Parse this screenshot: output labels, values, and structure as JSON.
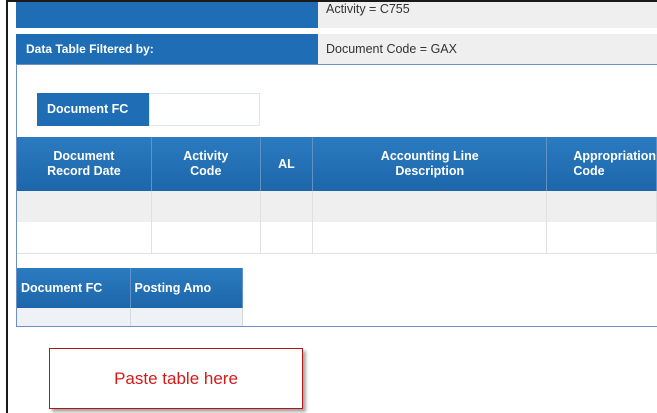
{
  "filters": [
    {
      "label": "",
      "value": "Activity = C755"
    },
    {
      "label": "Data Table Filtered by:",
      "value": "Document Code = GAX"
    }
  ],
  "top_tab": {
    "label": "Document FC"
  },
  "table_main": {
    "headers": [
      "Document\nRecord Date",
      "Activity\nCode",
      "AL",
      "Accounting Line\nDescription",
      "Appropriation\nCode"
    ]
  },
  "table_small": {
    "headers": [
      "Document FC",
      "Posting Amo"
    ]
  },
  "paste_box": {
    "text": "Paste table here"
  },
  "colors": {
    "header_blue": "#1f6eb5",
    "panel_border": "#6c8fc4",
    "paste_text": "#d21a1a",
    "paste_border": "#b01818"
  }
}
